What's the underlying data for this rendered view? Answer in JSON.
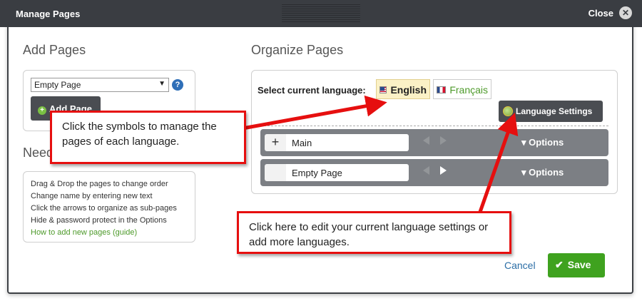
{
  "window": {
    "title": "Manage Pages",
    "close_label": "Close"
  },
  "add_pages": {
    "heading": "Add Pages",
    "select_value": "Empty Page",
    "add_button_label": "Add Page"
  },
  "need_help": {
    "heading": "Need",
    "lines": [
      "Drag & Drop the pages to change order",
      "Change name by entering new text",
      "Click the arrows to organize as sub-pages",
      "Hide & password protect in the Options"
    ],
    "link": "How to add new pages (guide)"
  },
  "organize": {
    "heading": "Organize Pages",
    "language_label": "Select current language:",
    "languages": [
      {
        "name": "English",
        "flag": "us-flag",
        "active": true
      },
      {
        "name": "Français",
        "flag": "fr-flag",
        "active": false
      }
    ],
    "language_settings_label": "Language Settings",
    "pages": [
      {
        "name": "Main",
        "options_label": "▾ Options",
        "has_plus": true
      },
      {
        "name": "Empty Page",
        "options_label": "▾ Options",
        "has_plus": false
      }
    ]
  },
  "callouts": {
    "symbols": "Click the symbols to manage the pages of each language.",
    "settings": "Click here to edit your current language settings or add more languages."
  },
  "footer": {
    "cancel_label": "Cancel",
    "save_label": "Save"
  },
  "colors": {
    "titlebar": "#3a3d42",
    "accent_green": "#3fa21f",
    "callout_red": "#e60f0f",
    "link": "#2b6ea6"
  }
}
